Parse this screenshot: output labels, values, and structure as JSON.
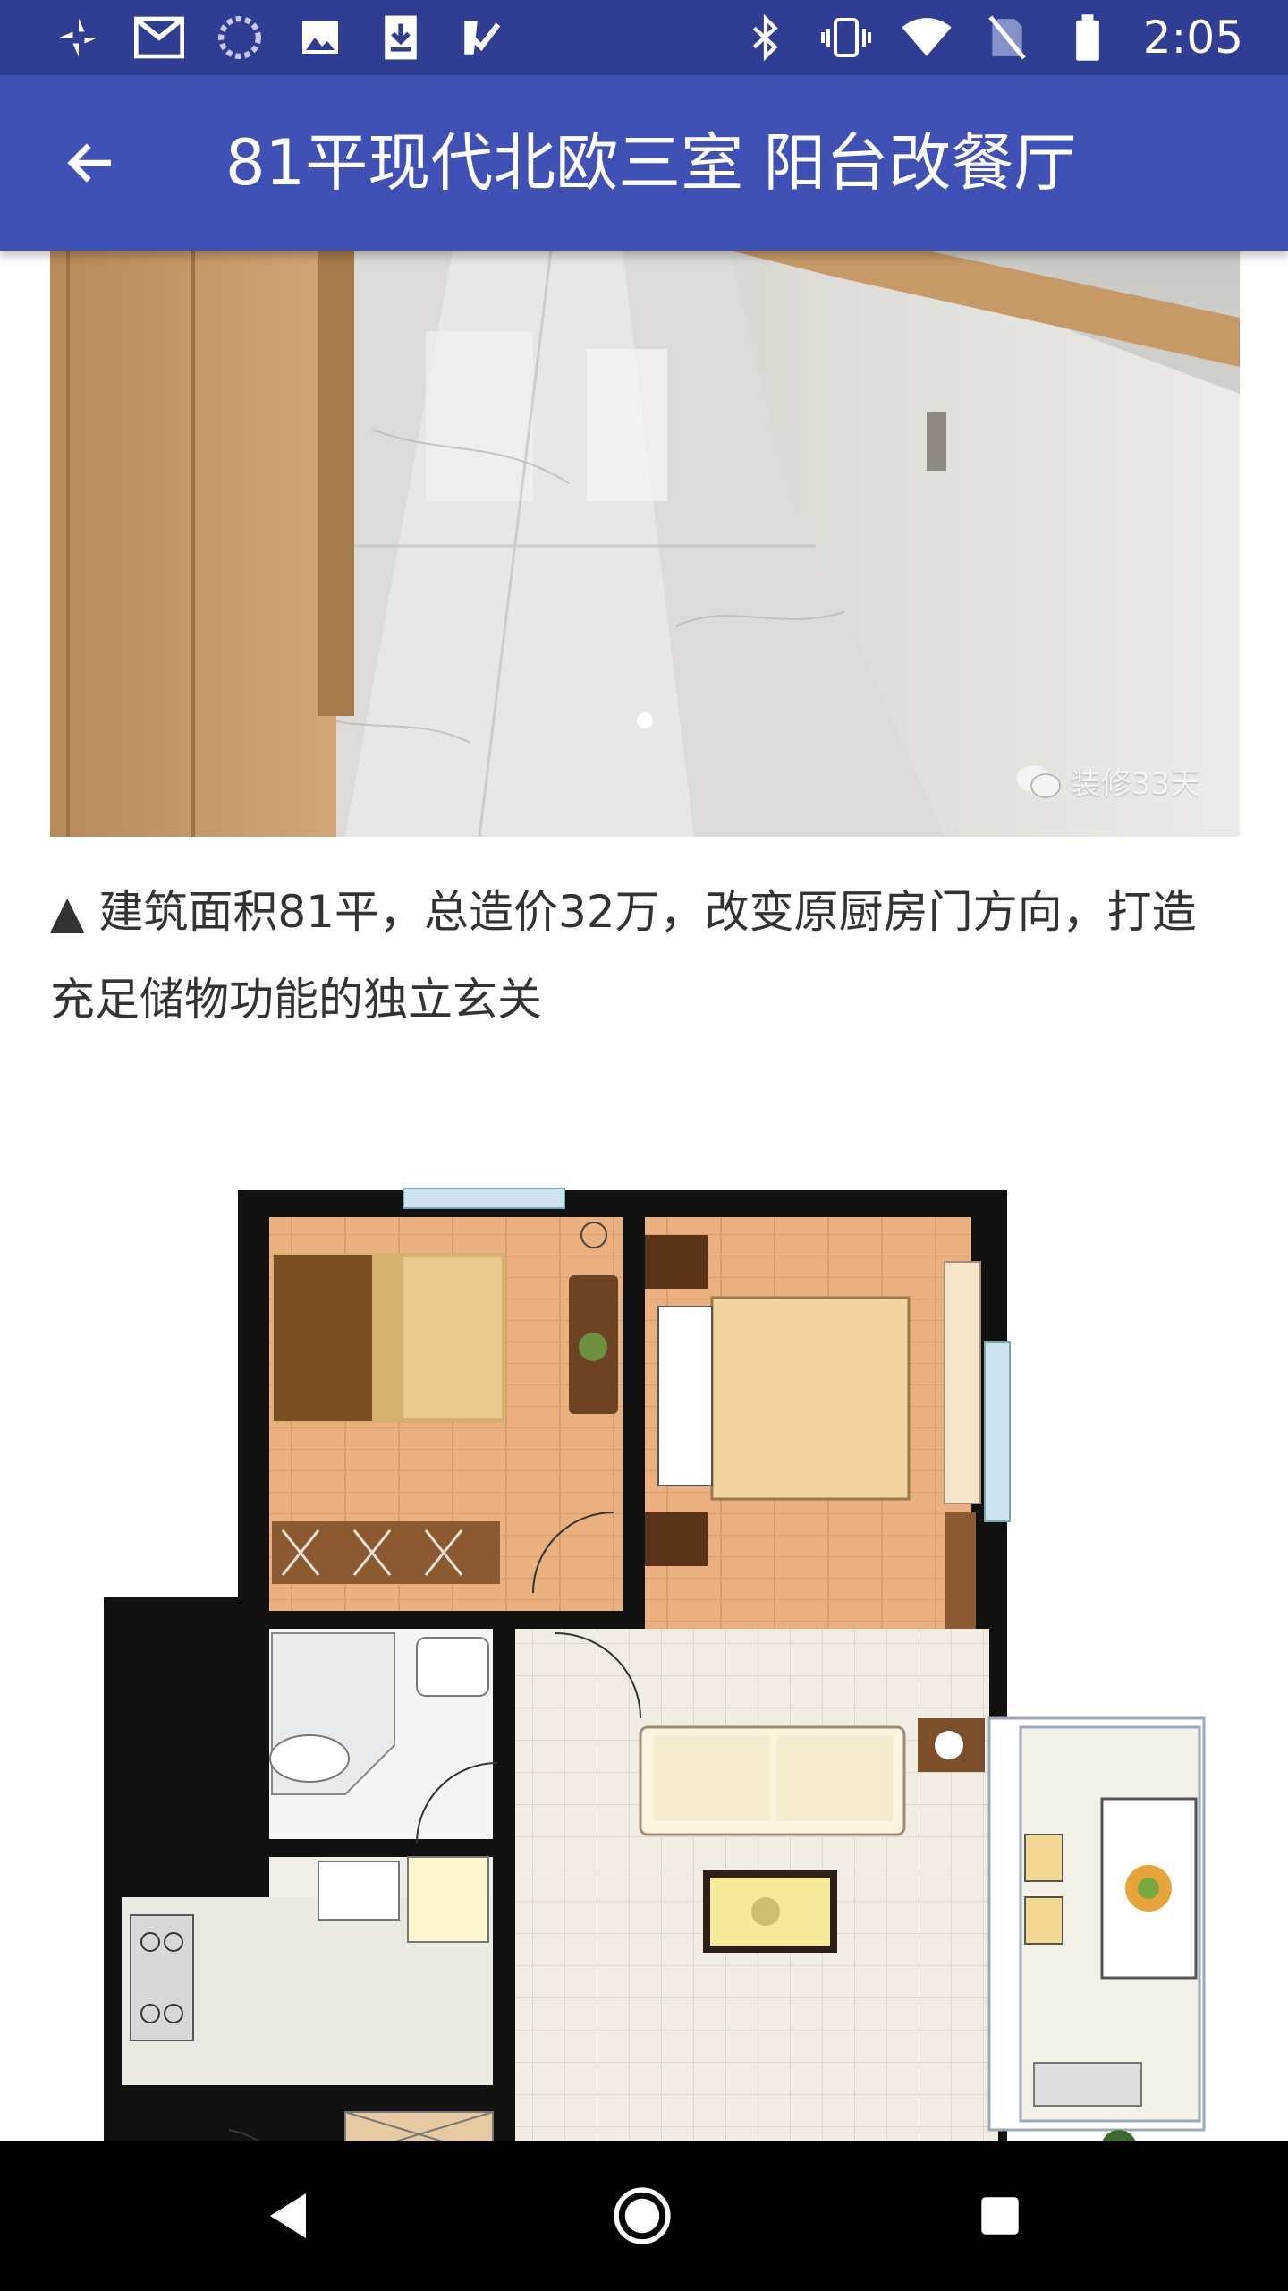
{
  "status_bar": {
    "time": "2:05",
    "left_icons": [
      "pinwheel-icon",
      "gmail-icon",
      "loading-icon",
      "image-icon",
      "download-icon",
      "task-icon"
    ],
    "right_icons": [
      "bluetooth-icon",
      "vibrate-icon",
      "wifi-icon",
      "no-sim-icon",
      "battery-icon"
    ]
  },
  "app_bar": {
    "title": "81平现代北欧三室 阳台改餐厅",
    "back_icon": "arrow-back-icon"
  },
  "article": {
    "photo_watermark": "装修33天",
    "caption": "▲ 建筑面积81平，总造价32万，改变原厨房门方向，打造充足储物功能的独立玄关"
  },
  "nav_bar": {
    "icons": [
      "back-triangle-icon",
      "home-circle-icon",
      "recents-square-icon"
    ]
  },
  "colors": {
    "status_bar": "#2f3d92",
    "app_bar": "#3f51b5",
    "nav_bar": "#000000"
  }
}
